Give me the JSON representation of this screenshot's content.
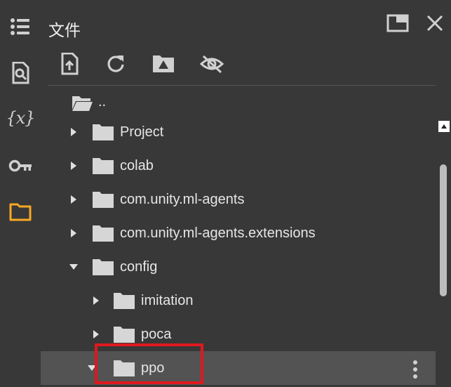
{
  "panel": {
    "title": "文件",
    "colors": {
      "background": "#383838",
      "accent": "#f9a825",
      "selected_row": "#535353",
      "highlight": "#e0181e"
    }
  },
  "rail": {
    "icons": [
      "table-of-contents-icon",
      "find-replace-icon",
      "variables-icon",
      "secrets-key-icon",
      "files-folder-icon"
    ],
    "variables_glyph": "{x}"
  },
  "header": {
    "buttons": [
      "open-in-tab-icon",
      "close-icon"
    ]
  },
  "toolbar": {
    "buttons": [
      "upload-file-icon",
      "refresh-icon",
      "mount-drive-icon",
      "toggle-hidden-files-icon"
    ]
  },
  "tree": {
    "parent_label": "..",
    "items": [
      {
        "label": "Project",
        "expanded": false,
        "depth": 0
      },
      {
        "label": "colab",
        "expanded": false,
        "depth": 0
      },
      {
        "label": "com.unity.ml-agents",
        "expanded": false,
        "depth": 0
      },
      {
        "label": "com.unity.ml-agents.extensions",
        "expanded": false,
        "depth": 0
      },
      {
        "label": "config",
        "expanded": true,
        "depth": 0
      },
      {
        "label": "imitation",
        "expanded": false,
        "depth": 1
      },
      {
        "label": "poca",
        "expanded": false,
        "depth": 1
      },
      {
        "label": "ppo",
        "expanded": true,
        "depth": 1,
        "selected": true
      }
    ]
  }
}
